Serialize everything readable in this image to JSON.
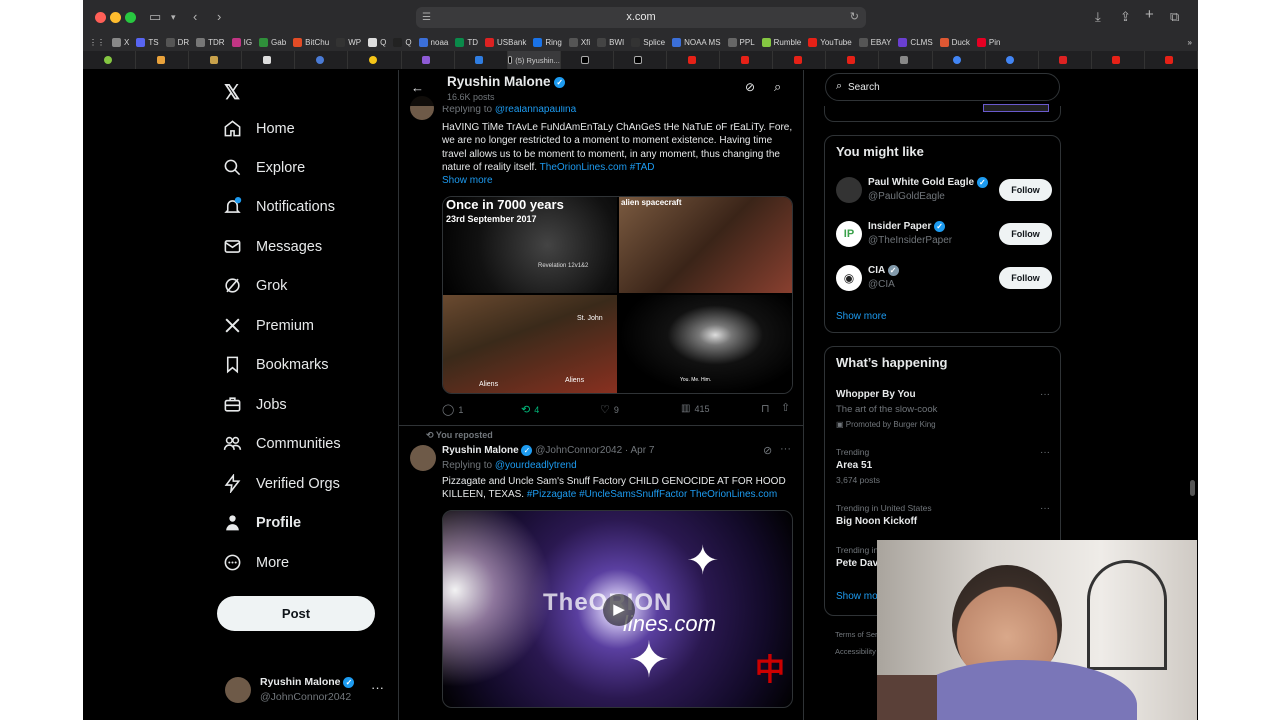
{
  "browser": {
    "url": "x.com",
    "bookmarks": [
      "X",
      "TS",
      "DR",
      "TDR",
      "IG",
      "Gab",
      "BitChu",
      "WP",
      "Q",
      "Q",
      "noaa",
      "TD",
      "USBank",
      "Ring",
      "Xfi",
      "BWI",
      "Splice",
      "NOAA MS",
      "PPL",
      "Rumble",
      "YouTube",
      "EBAY",
      "CLMS",
      "Duck",
      "Pin"
    ],
    "active_tab": "(5) Ryushin..."
  },
  "sidebar": {
    "items": [
      "Home",
      "Explore",
      "Notifications",
      "Messages",
      "Grok",
      "Premium",
      "Bookmarks",
      "Jobs",
      "Communities",
      "Verified Orgs",
      "Profile",
      "More"
    ],
    "notification_badge": "",
    "post_button": "Post",
    "account_name": "Ryushin Malone",
    "account_handle": "@JohnConnor2042"
  },
  "feed": {
    "header_name": "Ryushin Malone",
    "header_posts": "16.6K posts",
    "tweet1": {
      "replying_prefix": "Replying to",
      "replying_to": "@realannapaulina",
      "text": "HaVING TiMe TrAvLe FuNdAmEnTaLy ChAnGeS tHe NaTuE oF rEaLiTy.  Fore, we are no longer restricted to  a moment to moment existence. Having time travel allows us to be moment to moment,  in any moment, thus changing the nature of reality itself.",
      "link": "TheOrionLines.com",
      "hashtag": "#TAD",
      "show_more": "Show more",
      "image_titles": [
        "Once in 7000 years",
        "23rd September  2017",
        "alien spacecraft",
        "Revelation 12v1&2",
        "St. John",
        "Aliens",
        "Aliens",
        "You. Me. Him."
      ],
      "replies": "1",
      "reposts": "4",
      "likes": "9",
      "views": "415"
    },
    "tweet2": {
      "reposted_label": "You reposted",
      "name": "Ryushin Malone",
      "handle": "@JohnConnor2042",
      "date": "· Apr 7",
      "replying_prefix": "Replying to",
      "replying_to": "@yourdeadlytrend",
      "text": "Pizzagate and Uncle Sam's Snuff Factory CHILD GENOCIDE AT FOR HOOD KILLEEN, TEXAS.",
      "hashtags": "#Pizzagate #UncleSamsSnuffFactor TheOrionLines.com",
      "video_text_1": "TheORION",
      "video_text_2": "lines.com"
    }
  },
  "right": {
    "search_placeholder": "Search",
    "you_might_like_title": "You might like",
    "suggestions": [
      {
        "name": "Paul White Gold Eagle",
        "handle": "@PaulGoldEagle",
        "button": "Follow"
      },
      {
        "name": "Insider Paper",
        "handle": "@TheInsiderPaper",
        "button": "Follow"
      },
      {
        "name": "CIA",
        "handle": "@CIA",
        "button": "Follow"
      }
    ],
    "show_more": "Show more",
    "happening_title": "What’s happening",
    "trends": [
      {
        "context": "",
        "title": "Whopper By You",
        "sub": "The art of the slow-cook",
        "extra": "Promoted by Burger King"
      },
      {
        "context": "Trending",
        "title": "Area 51",
        "sub": "3,674 posts",
        "extra": ""
      },
      {
        "context": "Trending in United States",
        "title": "Big Noon Kickoff",
        "sub": "",
        "extra": ""
      },
      {
        "context": "Trending in",
        "title": "Pete Dav",
        "sub": "",
        "extra": ""
      }
    ],
    "show_more_2": "Show mo",
    "footer_1": "Terms of Ser",
    "footer_2": "Accessibility"
  }
}
